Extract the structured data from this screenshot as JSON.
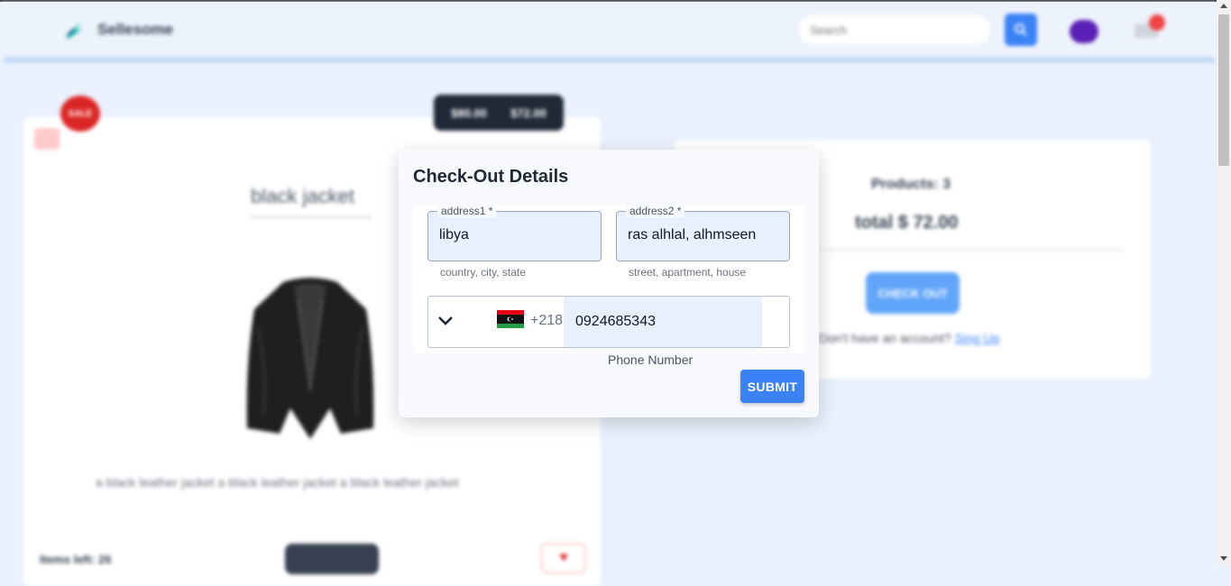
{
  "navbar": {
    "brand": "Sellesome",
    "search_placeholder": "Search"
  },
  "product": {
    "sale_badge": "SALE",
    "price_old": "$80.00",
    "price_new": "$72.00",
    "title": "black jacket",
    "description": "a black leather jacket a black leather jacket a black leather jacket",
    "items_left": "Items left: 26"
  },
  "summary": {
    "products_count": "Products: 3",
    "total": "total $ 72.00",
    "checkout_label": "CHECK OUT",
    "signup_prompt": "Don't have an account?",
    "signup_link": "Sing Up"
  },
  "modal": {
    "title": "Check-Out Details",
    "address1": {
      "label": "address1 *",
      "value": "libya",
      "helper": "country, city, state"
    },
    "address2": {
      "label": "address2 *",
      "value": "ras alhlal, alhmseen",
      "helper": "street, apartment, house"
    },
    "phone": {
      "country_code": "+218",
      "value": "0924685343",
      "label": "Phone Number",
      "flag": "libya-flag-icon"
    },
    "submit_label": "SUBMIT"
  },
  "colors": {
    "accent": "#3b82f6",
    "page_bg": "#eaf1fc",
    "danger": "#dc2626"
  }
}
